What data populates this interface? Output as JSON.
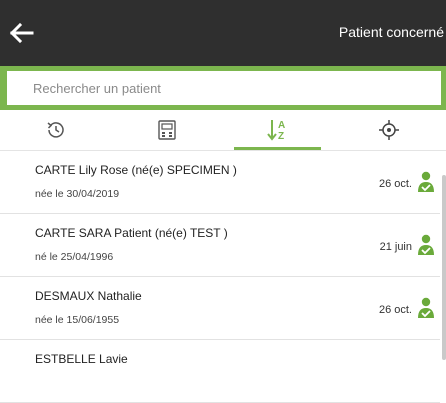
{
  "header": {
    "title": "Patient concerné"
  },
  "search": {
    "placeholder": "Rechercher un patient",
    "value": ""
  },
  "tabs": [
    {
      "icon": "history-icon",
      "active": false
    },
    {
      "icon": "calendar-icon",
      "active": false
    },
    {
      "icon": "sort-alpha-icon",
      "active": true
    },
    {
      "icon": "locate-icon",
      "active": false
    }
  ],
  "patients": [
    {
      "name": "CARTE Lily Rose (né(e) SPECIMEN )",
      "birth": "née le 30/04/2019",
      "date": "26 oct."
    },
    {
      "name": "CARTE SARA Patient (né(e) TEST )",
      "birth": "né le 25/04/1996",
      "date": "21 juin"
    },
    {
      "name": "DESMAUX Nathalie",
      "birth": "née le 15/06/1955",
      "date": "26 oct."
    },
    {
      "name": "ESTBELLE Lavie",
      "birth": "",
      "date": ""
    }
  ],
  "colors": {
    "accent": "#7cb64e",
    "topbar": "#2f2f2f",
    "person_icon": "#6aaa3a"
  }
}
